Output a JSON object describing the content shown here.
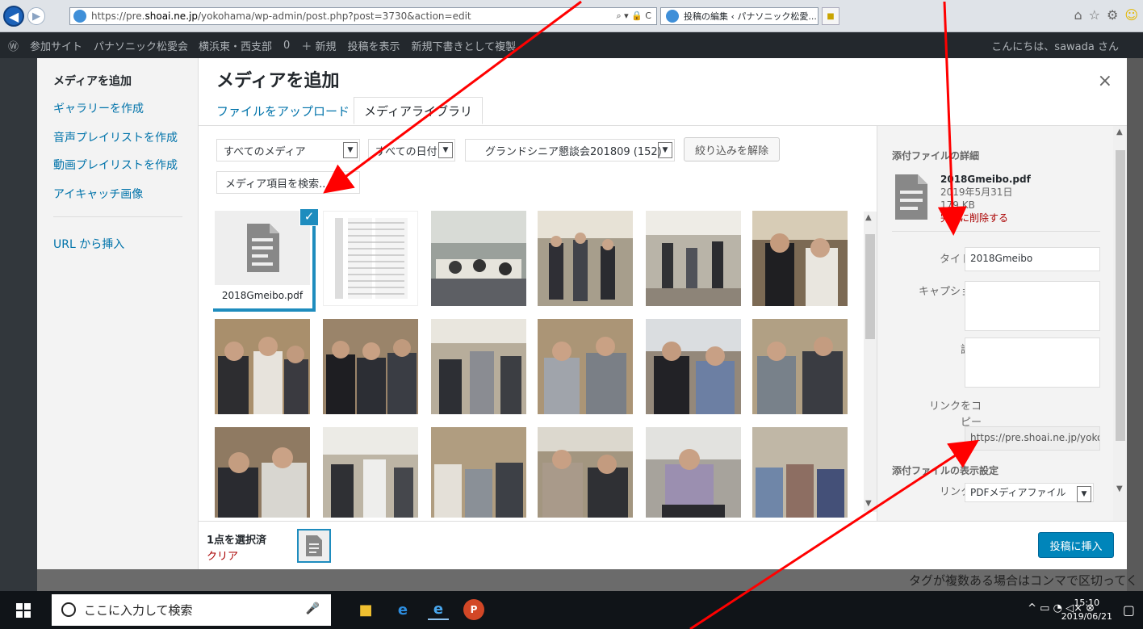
{
  "browser": {
    "url_prefix": "https://pre.",
    "url_host": "shoai.ne.jp",
    "url_path": "/yokohama/wp-admin/post.php?post=3730&action=edit",
    "addr_tools": "⌕ ▾ 🔒 C",
    "tab_title": "投稿の編集 ‹ パナソニック松愛...",
    "tab_close": "×"
  },
  "admin_bar": {
    "items": [
      "参加サイト",
      "パナソニック松愛会　横浜東・西支部",
      "0",
      "＋ 新規",
      "投稿を表示",
      "新規下書きとして複製"
    ],
    "greeting": "こんにちは、sawada さん"
  },
  "modal": {
    "title": "メディアを追加",
    "close": "×",
    "menu": [
      "メディアを追加",
      "ギャラリーを作成",
      "音声プレイリストを作成",
      "動画プレイリストを作成",
      "アイキャッチ画像",
      "URL から挿入"
    ],
    "tabs": [
      "ファイルをアップロード",
      "メディアライブラリ"
    ],
    "filters": {
      "media_type": "すべてのメディア",
      "date": "すべての日付",
      "category": "グランドシニア懇談会201809 (152)",
      "clear_button": "絞り込みを解除"
    },
    "search_placeholder": "メディア項目を検索...",
    "selected_item": {
      "filename": "2018Gmeibo.pdf"
    }
  },
  "attachment_details": {
    "heading": "添付ファイルの詳細",
    "filename": "2018Gmeibo.pdf",
    "date": "2019年5月31日",
    "size": "179 KB",
    "delete": "完全に削除する",
    "title_label": "タイトル",
    "title_value": "2018Gmeibo",
    "caption_label": "キャプション",
    "description_label": "説明",
    "copy_link_label_1": "リンクをコ",
    "copy_link_label_2": "ピー",
    "copy_link_value": "https://pre.shoai.ne.jp/yoko",
    "display_heading": "添付ファイルの表示設定",
    "link_to_label": "リンク先",
    "link_to_value": "PDFメディアファイル"
  },
  "toolbar": {
    "selected_count": "1点を選択済",
    "clear": "クリア",
    "insert_button": "投稿に挿入"
  },
  "background": {
    "hint": "タグが複数ある場合はコンマで区切ってく"
  },
  "taskbar": {
    "search_placeholder": "ここに入力して検索",
    "time": "15:10",
    "date": "2019/06/21"
  },
  "colors": {
    "accent": "#0085ba",
    "selection": "#1e8cbe",
    "arrow": "#ff0000",
    "delete": "#aa0000"
  }
}
